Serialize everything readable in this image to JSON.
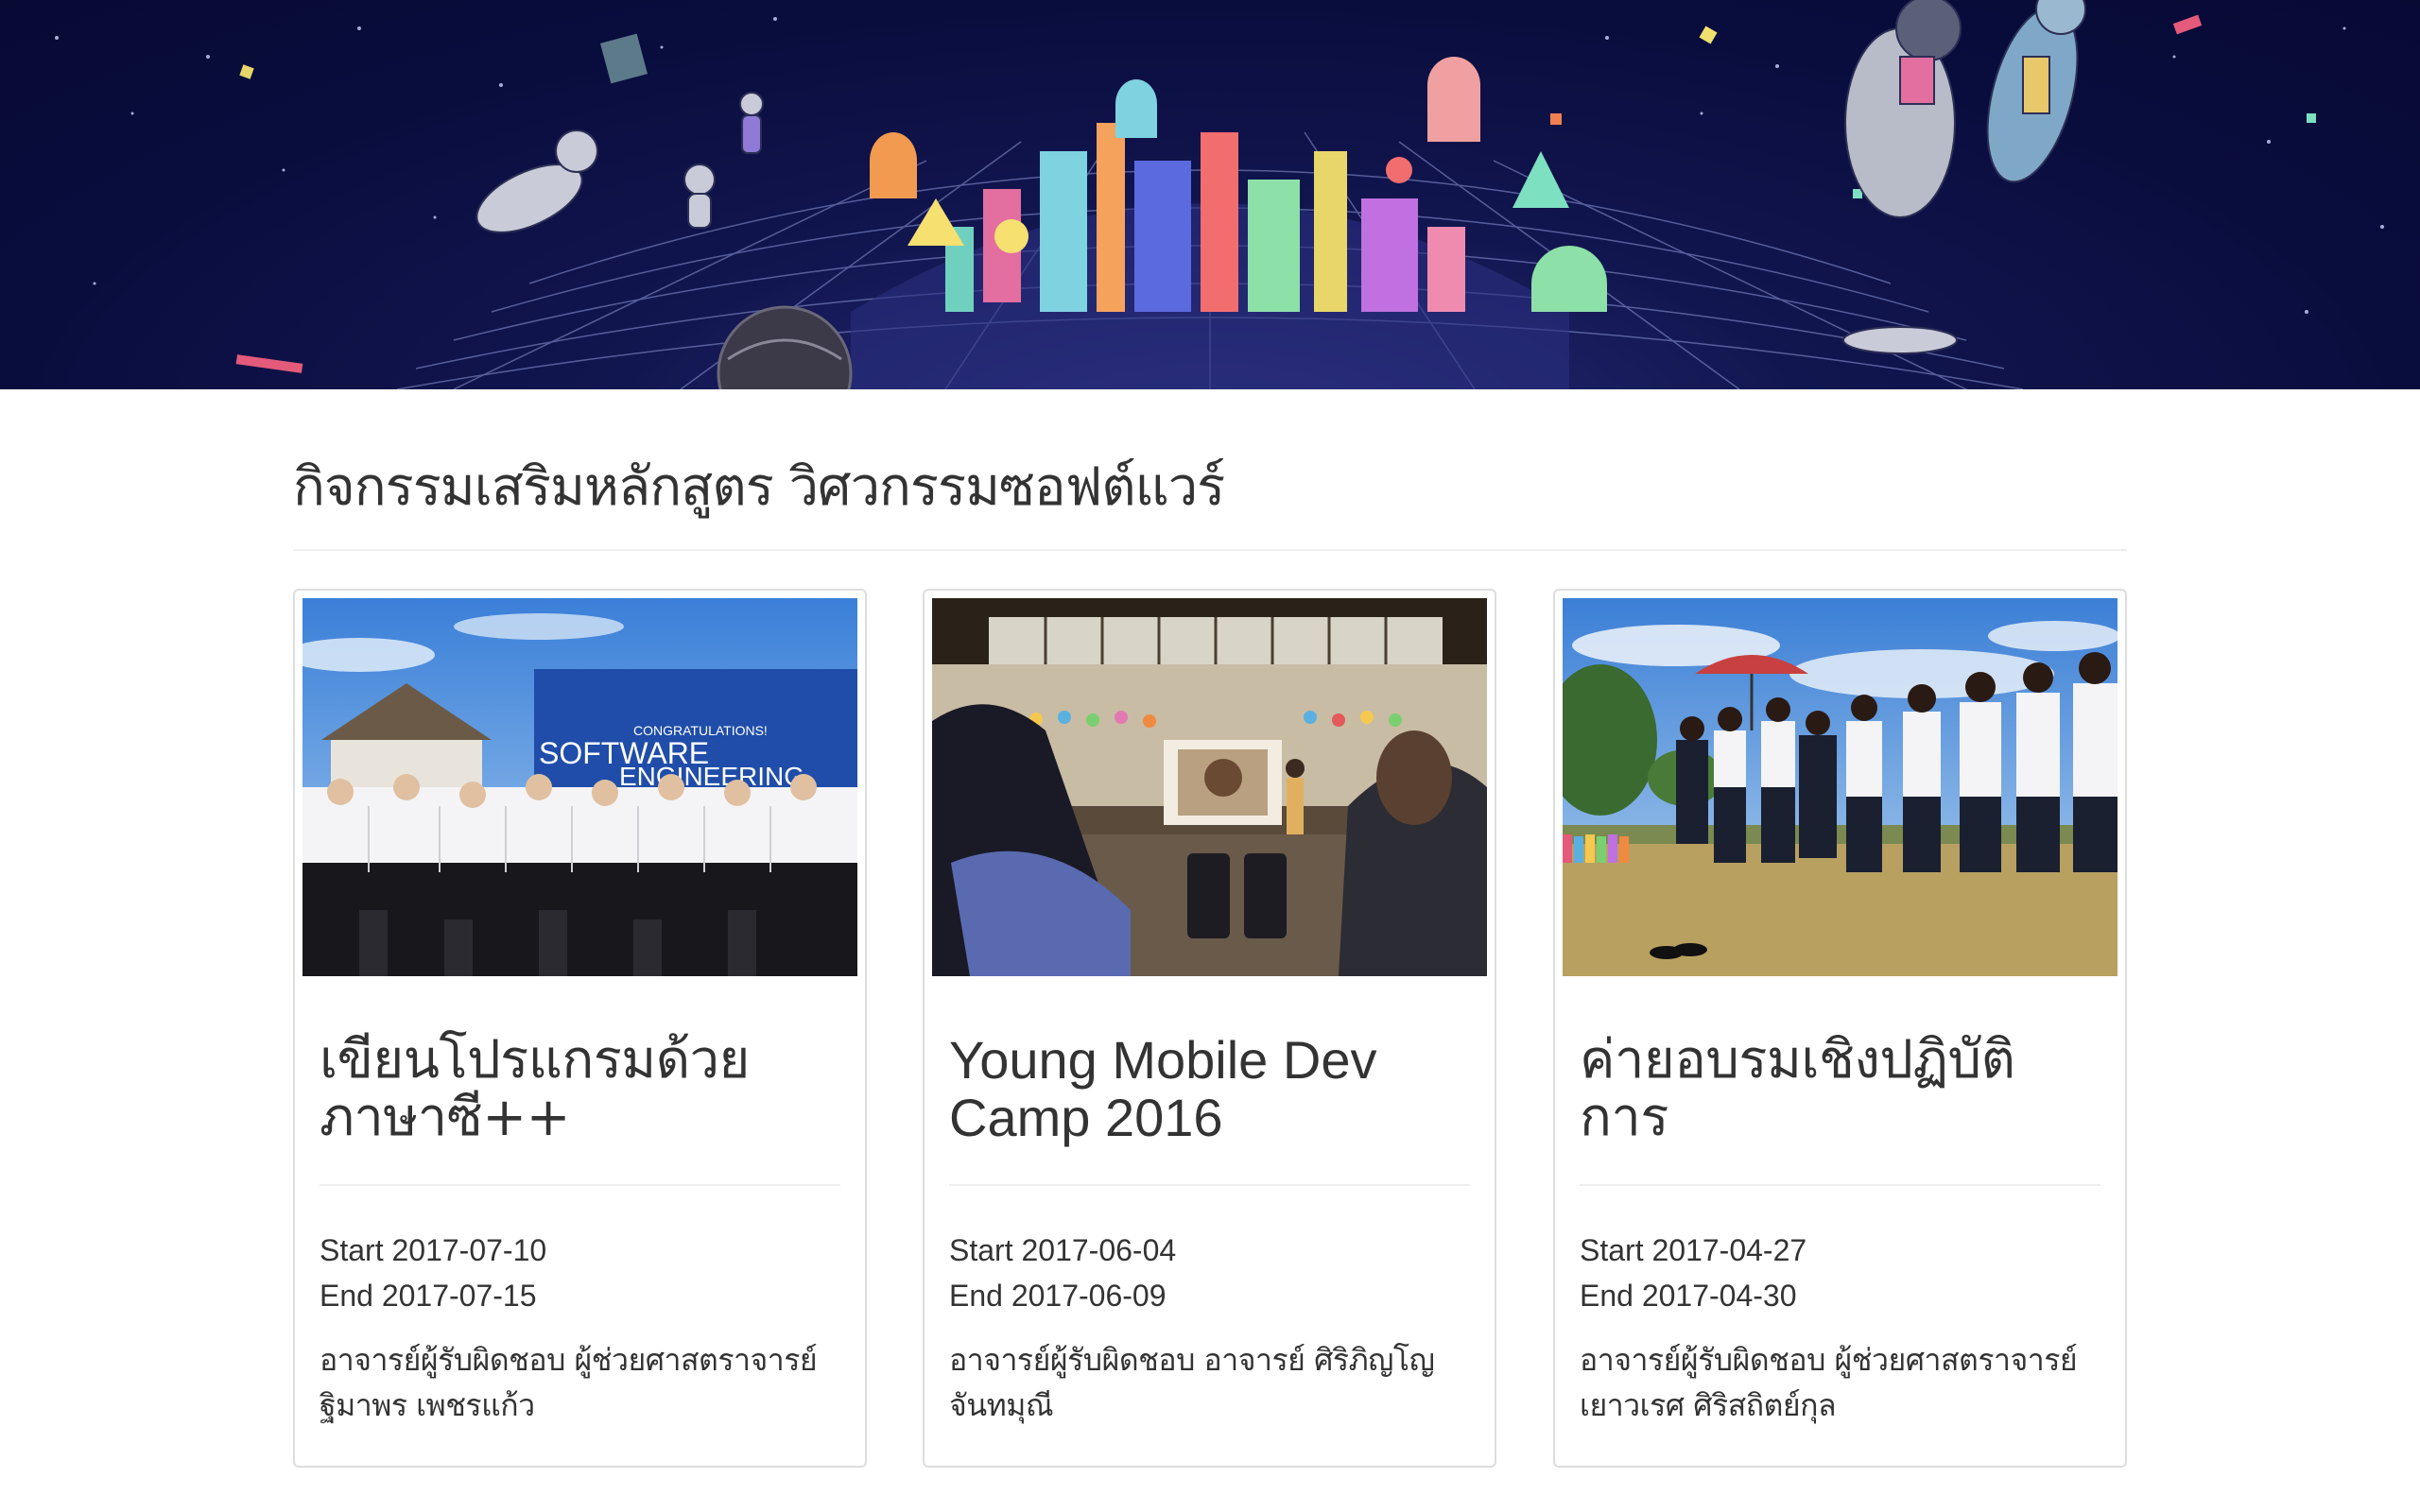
{
  "header": {
    "banner_label": "banner"
  },
  "page": {
    "title": "กิจกรรมเสริมหลักสูตร วิศวกรรมซอฟต์แวร์"
  },
  "cards": [
    {
      "title": "เขียนโปรแกรมด้วยภาษาซี++",
      "start": "Start 2017-07-10",
      "end": "End 2017-07-15",
      "teacher": "อาจารย์ผู้รับผิดชอบ ผู้ช่วยศาสตราจารย์ ฐิมาพร เพชรแก้ว",
      "photo_sign_line1": "CONGRATULATIONS!",
      "photo_sign_line2": "SOFTWARE",
      "photo_sign_line3": "ENGINEERING"
    },
    {
      "title": "Young Mobile Dev Camp 2016",
      "start": "Start 2017-06-04",
      "end": "End 2017-06-09",
      "teacher": "อาจารย์ผู้รับผิดชอบ อาจารย์ ศิริภิญโญ จันทมุณี"
    },
    {
      "title": "ค่ายอบรมเชิงปฏิบัติการ",
      "start": "Start 2017-04-27",
      "end": "End 2017-04-30",
      "teacher": "อาจารย์ผู้รับผิดชอบ ผู้ช่วยศาสตราจารย์ เยาวเรศ ศิริสถิตย์กุล"
    }
  ],
  "colors": {
    "text": "#333333",
    "card_border": "#dddddd",
    "divider": "#eeeeee",
    "hero_bg": "#090d3e"
  }
}
